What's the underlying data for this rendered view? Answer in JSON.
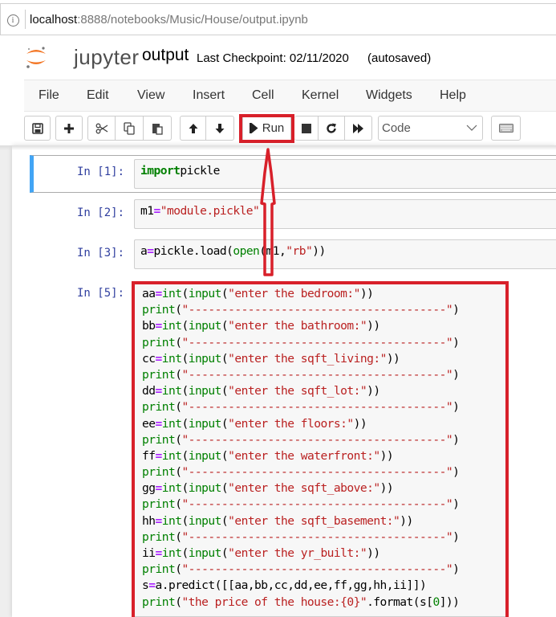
{
  "browser": {
    "info_icon": "info-circle-icon",
    "url_host": "localhost",
    "url_rest": ":8888/notebooks/Music/House/output.ipynb"
  },
  "header": {
    "logo_text": "jupyter",
    "notebook_name": "output",
    "checkpoint": "Last Checkpoint: 02/11/2020",
    "autosave": "(autosaved)"
  },
  "menu": [
    "File",
    "Edit",
    "View",
    "Insert",
    "Cell",
    "Kernel",
    "Widgets",
    "Help"
  ],
  "toolbar": {
    "save_icon": "save-icon",
    "insert_icon": "plus-icon",
    "cut_icon": "scissors-icon",
    "copy_icon": "copy-icon",
    "paste_icon": "paste-icon",
    "move_up_icon": "arrow-up-icon",
    "move_down_icon": "arrow-down-icon",
    "run_label": "Run",
    "interrupt_icon": "stop-icon",
    "restart_icon": "restart-icon",
    "restart_run_icon": "fast-forward-icon",
    "cell_type": "Code",
    "keyboard_icon": "keyboard-icon"
  },
  "annotation_color": "#d8202a",
  "cells": [
    {
      "prompt": "In [1]:",
      "lines": [
        [
          [
            "kw",
            "import"
          ],
          [
            "",
            "pickle"
          ]
        ]
      ]
    },
    {
      "prompt": "In [2]:",
      "lines": [
        [
          [
            "",
            "m1"
          ],
          [
            "op",
            "="
          ],
          [
            "str",
            "\"module.pickle\""
          ]
        ]
      ]
    },
    {
      "prompt": "In [3]:",
      "lines": [
        [
          [
            "",
            "a"
          ],
          [
            "op",
            "="
          ],
          [
            "",
            "pickle.load("
          ],
          [
            "bi",
            "open"
          ],
          [
            "",
            "(m1,"
          ],
          [
            "str",
            "\"rb\""
          ],
          [
            "",
            "))"
          ]
        ]
      ]
    },
    {
      "prompt": "In [5]:",
      "lines": [
        [
          [
            "",
            "aa"
          ],
          [
            "op",
            "="
          ],
          [
            "bi",
            "int"
          ],
          [
            "",
            "("
          ],
          [
            "bi",
            "input"
          ],
          [
            "",
            "("
          ],
          [
            "str",
            "\"enter the bedroom:\""
          ],
          [
            "",
            "))"
          ]
        ],
        [
          [
            "bi",
            "print"
          ],
          [
            "",
            "("
          ],
          [
            "str",
            "\"---------------------------------------\""
          ],
          [
            "",
            ")"
          ]
        ],
        [
          [
            "",
            "bb"
          ],
          [
            "op",
            "="
          ],
          [
            "bi",
            "int"
          ],
          [
            "",
            "("
          ],
          [
            "bi",
            "input"
          ],
          [
            "",
            "("
          ],
          [
            "str",
            "\"enter the bathroom:\""
          ],
          [
            "",
            "))"
          ]
        ],
        [
          [
            "bi",
            "print"
          ],
          [
            "",
            "("
          ],
          [
            "str",
            "\"---------------------------------------\""
          ],
          [
            "",
            ")"
          ]
        ],
        [
          [
            "",
            "cc"
          ],
          [
            "op",
            "="
          ],
          [
            "bi",
            "int"
          ],
          [
            "",
            "("
          ],
          [
            "bi",
            "input"
          ],
          [
            "",
            "("
          ],
          [
            "str",
            "\"enter the sqft_living:\""
          ],
          [
            "",
            "))"
          ]
        ],
        [
          [
            "bi",
            "print"
          ],
          [
            "",
            "("
          ],
          [
            "str",
            "\"---------------------------------------\""
          ],
          [
            "",
            ")"
          ]
        ],
        [
          [
            "",
            "dd"
          ],
          [
            "op",
            "="
          ],
          [
            "bi",
            "int"
          ],
          [
            "",
            "("
          ],
          [
            "bi",
            "input"
          ],
          [
            "",
            "("
          ],
          [
            "str",
            "\"enter the sqft_lot:\""
          ],
          [
            "",
            "))"
          ]
        ],
        [
          [
            "bi",
            "print"
          ],
          [
            "",
            "("
          ],
          [
            "str",
            "\"---------------------------------------\""
          ],
          [
            "",
            ")"
          ]
        ],
        [
          [
            "",
            "ee"
          ],
          [
            "op",
            "="
          ],
          [
            "bi",
            "int"
          ],
          [
            "",
            "("
          ],
          [
            "bi",
            "input"
          ],
          [
            "",
            "("
          ],
          [
            "str",
            "\"enter the floors:\""
          ],
          [
            "",
            "))"
          ]
        ],
        [
          [
            "bi",
            "print"
          ],
          [
            "",
            "("
          ],
          [
            "str",
            "\"---------------------------------------\""
          ],
          [
            "",
            ")"
          ]
        ],
        [
          [
            "",
            "ff"
          ],
          [
            "op",
            "="
          ],
          [
            "bi",
            "int"
          ],
          [
            "",
            "("
          ],
          [
            "bi",
            "input"
          ],
          [
            "",
            "("
          ],
          [
            "str",
            "\"enter the waterfront:\""
          ],
          [
            "",
            "))"
          ]
        ],
        [
          [
            "bi",
            "print"
          ],
          [
            "",
            "("
          ],
          [
            "str",
            "\"---------------------------------------\""
          ],
          [
            "",
            ")"
          ]
        ],
        [
          [
            "",
            "gg"
          ],
          [
            "op",
            "="
          ],
          [
            "bi",
            "int"
          ],
          [
            "",
            "("
          ],
          [
            "bi",
            "input"
          ],
          [
            "",
            "("
          ],
          [
            "str",
            "\"enter the sqft_above:\""
          ],
          [
            "",
            "))"
          ]
        ],
        [
          [
            "bi",
            "print"
          ],
          [
            "",
            "("
          ],
          [
            "str",
            "\"---------------------------------------\""
          ],
          [
            "",
            ")"
          ]
        ],
        [
          [
            "",
            "hh"
          ],
          [
            "op",
            "="
          ],
          [
            "bi",
            "int"
          ],
          [
            "",
            "("
          ],
          [
            "bi",
            "input"
          ],
          [
            "",
            "("
          ],
          [
            "str",
            "\"enter the sqft_basement:\""
          ],
          [
            "",
            "))"
          ]
        ],
        [
          [
            "bi",
            "print"
          ],
          [
            "",
            "("
          ],
          [
            "str",
            "\"---------------------------------------\""
          ],
          [
            "",
            ")"
          ]
        ],
        [
          [
            "",
            "ii"
          ],
          [
            "op",
            "="
          ],
          [
            "bi",
            "int"
          ],
          [
            "",
            "("
          ],
          [
            "bi",
            "input"
          ],
          [
            "",
            "("
          ],
          [
            "str",
            "\"enter the yr_built:\""
          ],
          [
            "",
            "))"
          ]
        ],
        [
          [
            "bi",
            "print"
          ],
          [
            "",
            "("
          ],
          [
            "str",
            "\"---------------------------------------\""
          ],
          [
            "",
            ")"
          ]
        ],
        [
          [
            "",
            "s"
          ],
          [
            "op",
            "="
          ],
          [
            "",
            "a.predict([[aa,bb,cc,dd,ee,ff,gg,hh,ii]])"
          ]
        ],
        [
          [
            "bi",
            "print"
          ],
          [
            "",
            "("
          ],
          [
            "str",
            "\"the price of the house:{0}\""
          ],
          [
            "",
            ".format(s["
          ],
          [
            "num",
            "0"
          ],
          [
            "",
            "]))"
          ]
        ]
      ]
    }
  ]
}
